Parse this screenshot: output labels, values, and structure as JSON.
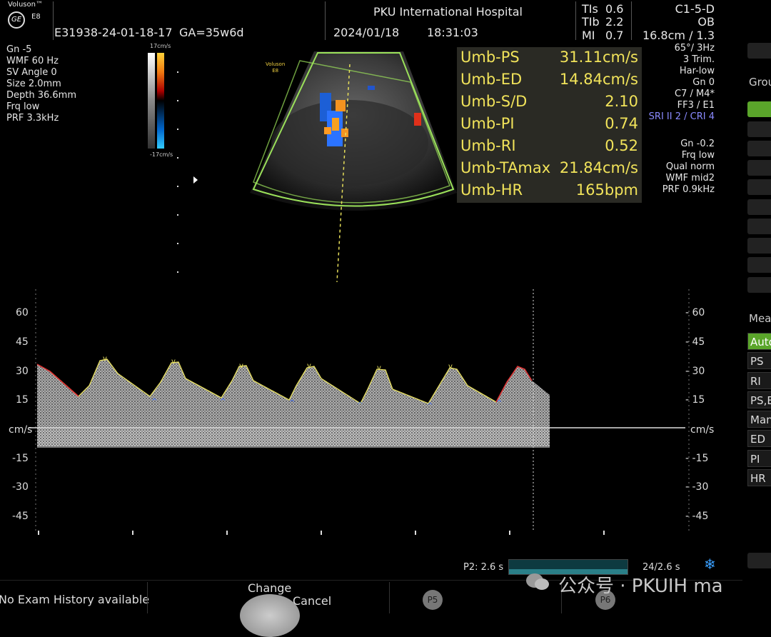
{
  "header": {
    "brand": "Voluson™",
    "brand_model": "E8",
    "logo": "GE",
    "hospital": "PKU International Hospital",
    "patient_id": "E31938-24-01-18-17",
    "ga": "GA=35w6d",
    "date": "2024/01/18",
    "time": "18:31:03",
    "tis": "TIs",
    "tis_v": "0.6",
    "tib": "TIb",
    "tib_v": "2.2",
    "mi": "MI",
    "mi_v": "0.7",
    "probe": "C1-5-D",
    "preset": "OB",
    "depth_zoom": "16.8cm / 1.3"
  },
  "left_params": {
    "lines": [
      "Gn  -5",
      "WMF 60 Hz",
      "SV Angle  0",
      "Size  2.0mm",
      "Depth 36.6mm",
      "Frq low",
      "PRF  3.3kHz"
    ]
  },
  "color_bar": {
    "top": "17cm/s",
    "bottom": "-17cm/s"
  },
  "image_label": {
    "brand": "Voluson",
    "model": "E8"
  },
  "measurements": [
    {
      "label": "Umb-PS",
      "value": "31.11cm/s"
    },
    {
      "label": "Umb-ED",
      "value": "14.84cm/s"
    },
    {
      "label": "Umb-S/D",
      "value": "2.10"
    },
    {
      "label": "Umb-PI",
      "value": "0.74"
    },
    {
      "label": "Umb-RI",
      "value": "0.52"
    },
    {
      "label": "Umb-TAmax",
      "value": "21.84cm/s"
    },
    {
      "label": "Umb-HR",
      "value": "165bpm"
    }
  ],
  "right_params": {
    "lines_top": [
      "65°/ 3Hz",
      "3 Trim.",
      "Har-low",
      "Gn  0",
      "C7 / M4*",
      "FF3 / E1"
    ],
    "sri": "SRI II 2 / CRI 4",
    "lines_bottom": [
      "Gn -0.2",
      "Frq low",
      "Qual norm",
      "WMF mid2",
      "PRF  0.9kHz"
    ]
  },
  "side_panel": {
    "group_label": "Grou",
    "measure_label": "Mea",
    "items": [
      "Auto",
      "PS",
      "RI",
      "PS,E",
      "Man",
      "ED",
      "PI",
      "HR"
    ]
  },
  "doppler_axis": {
    "ticks_left": [
      "60",
      "45",
      "30",
      "15",
      "cm/s",
      "-15",
      "-30",
      "-45"
    ],
    "ticks_right": [
      "- 60",
      "- 45",
      "- 30",
      "- 15",
      "cm/s",
      "- -15",
      "- -30",
      "- -45"
    ]
  },
  "footer": {
    "p2_label": "P2:  2.6 s",
    "frames": "24/2.6 s",
    "exam_history": "No Exam History available",
    "change": "Change",
    "cancel": "Cancel",
    "p5": "P5",
    "p6": "P6",
    "watermark": "公众号 · PKUIH ma"
  }
}
